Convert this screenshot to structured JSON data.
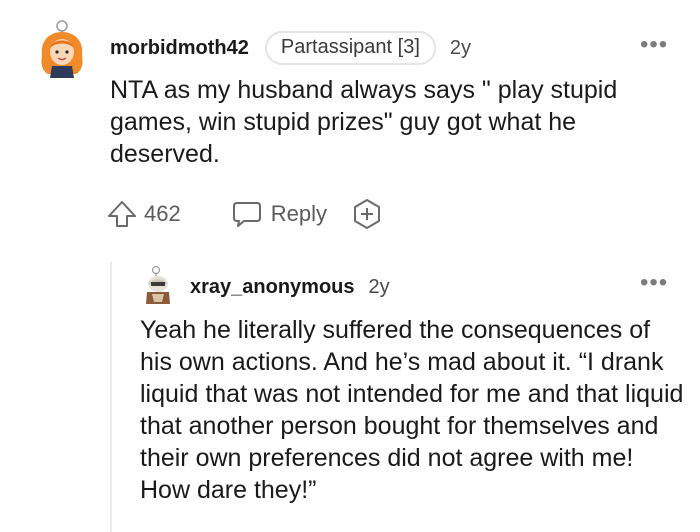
{
  "comment": {
    "username": "morbidmoth42",
    "flair": "Partassipant [3]",
    "age": "2y",
    "more_label": "•••",
    "body": "NTA as my husband always says \" play stupid games, win stupid prizes\" guy got what he deserved.",
    "votes": "462",
    "reply_label": "Reply",
    "icons": {
      "upvote": "upvote-arrow-icon",
      "reply": "speech-bubble-icon",
      "award": "award-plus-icon"
    }
  },
  "reply": {
    "username": "xray_anonymous",
    "age": "2y",
    "more_label": "•••",
    "body": "Yeah he literally suffered the consequences of his own actions. And he’s mad about it. “I drank liquid that was not intended for me and that liquid that another person bought for themselves and their own preferences did not agree with me! How dare they!”"
  },
  "colors": {
    "text": "#1a1a1b",
    "meta": "#7c7c7c",
    "flair_border": "#e3e4e6",
    "thread_line": "#e9eaeb"
  }
}
